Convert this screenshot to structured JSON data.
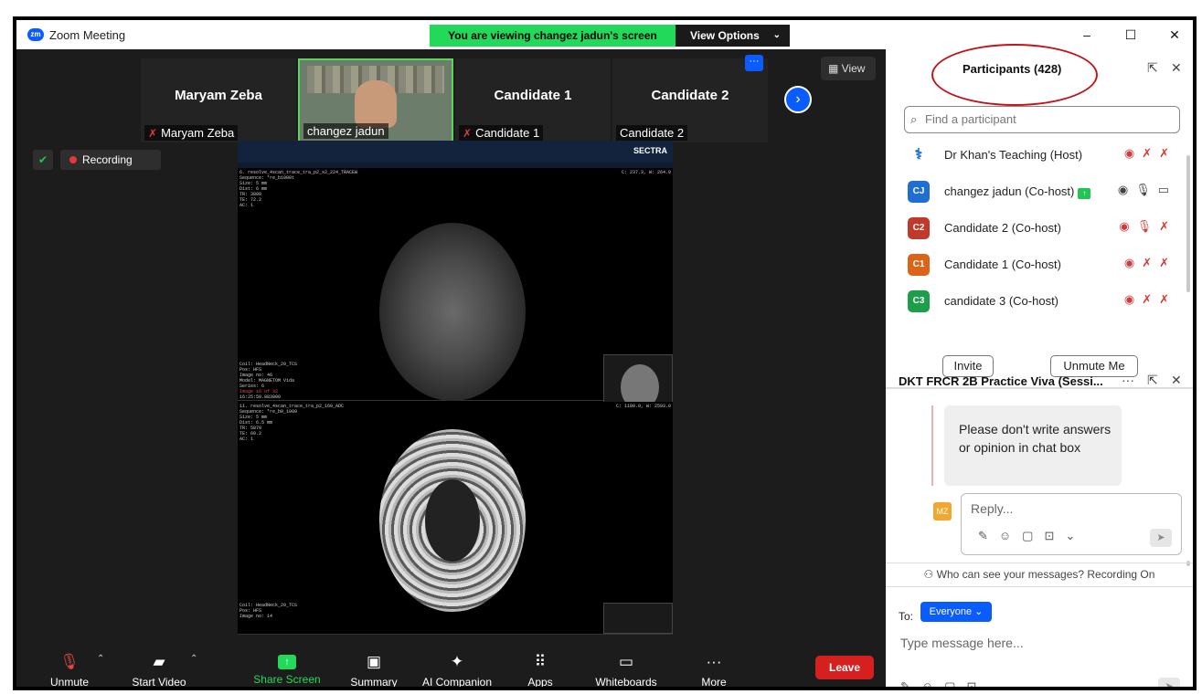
{
  "window": {
    "title": "Zoom Meeting",
    "logo_text": "zm",
    "banner": "You are viewing changez jadun's screen",
    "view_options": "View Options",
    "minimize": "–",
    "maximize": "☐",
    "close": "✕"
  },
  "thumbnails": [
    {
      "name": "Maryam Zeba",
      "label": "Maryam Zeba",
      "muted": true
    },
    {
      "name": "",
      "label": "changez jadun",
      "muted": false
    },
    {
      "name": "Candidate 1",
      "label": "Candidate 1",
      "muted": true
    },
    {
      "name": "Candidate 2",
      "label": "Candidate 2",
      "muted": false
    }
  ],
  "view_button": "View",
  "ellipsis": "···",
  "recording": "Recording",
  "shared_screen": {
    "sectra_logo": "SECTRA",
    "pane1_info": [
      "6. resolve_4scan_trace_tra_p2_s2_224_TRACEW",
      "Sequence: *re_b1000t",
      "Size: 5 mm",
      "Dist: 6 mm",
      "TR: 3800",
      "TE: 72.2",
      "AC: 1"
    ],
    "pane1_footer": [
      "Coil: HeadNeck_20_TCS",
      "Pos: HFS",
      "Image no: 46",
      "Model: MAGNETOM Vida",
      "Series: 6",
      "Image 16 of 32",
      "16:25:50.883000"
    ],
    "pane1_coords": "C: 237.3, W: 264.9",
    "pane2_info": [
      "11. resolve_4scan_trace_tra_p2_160_ADC",
      "Sequence: *re_b0_1000",
      "Size: 5 mm",
      "Dist: 6.5 mm",
      "TR: 5870",
      "TE: 60.2",
      "AC: 1"
    ],
    "pane2_footer": [
      "Coil: HeadNeck_20_TCS",
      "Pos: HFS",
      "Image no: 14"
    ],
    "pane2_coords": "C: 1180.0, W: 2593.0"
  },
  "toolbar": {
    "unmute": "Unmute",
    "start_video": "Start Video",
    "share_screen": "Share Screen",
    "summary": "Summary",
    "ai_companion": "AI Companion",
    "apps": "Apps",
    "whiteboards": "Whiteboards",
    "more": "More",
    "leave": "Leave"
  },
  "participants": {
    "title": "Participants (428)",
    "search_placeholder": "Find a participant",
    "list": [
      {
        "avatar": "",
        "name": "Dr Khan's Teaching (Host)",
        "color": "#ffffff"
      },
      {
        "avatar": "CJ",
        "name": "changez jadun (Co-host)",
        "color": "#1e6fd1"
      },
      {
        "avatar": "C2",
        "name": "Candidate 2 (Co-host)",
        "color": "#c0392b"
      },
      {
        "avatar": "C1",
        "name": "Candidate 1 (Co-host)",
        "color": "#d9641a"
      },
      {
        "avatar": "C3",
        "name": "candidate 3 (Co-host)",
        "color": "#1e9e4a"
      }
    ],
    "invite": "Invite",
    "unmute_me": "Unmute Me"
  },
  "chat": {
    "title": "DKT FRCR 2B Practice Viva (Sessi...",
    "message": "Please don't write answers or opinion in chat box",
    "reply_avatar": "MZ",
    "reply_placeholder": "Reply...",
    "visibility": "Who can see your messages? Recording On",
    "to_label": "To:",
    "recipient": "Everyone",
    "input_placeholder": "Type message here..."
  }
}
